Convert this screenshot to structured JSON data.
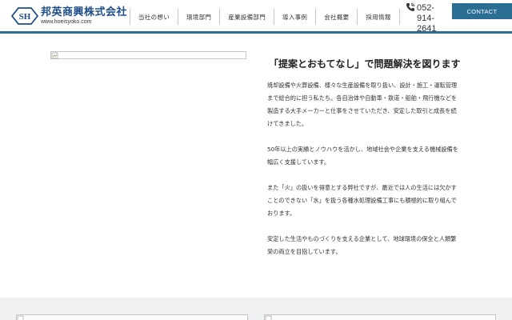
{
  "header": {
    "company_name": "邦英商興株式会社",
    "company_url": "www.hoeisyoko.com",
    "logo_icon": "sh-monogram-logo",
    "nav": [
      {
        "label": "当社の想い"
      },
      {
        "label": "環境部門"
      },
      {
        "label": "産業設備部門"
      },
      {
        "label": "導入事例"
      },
      {
        "label": "会社概要"
      },
      {
        "label": "採用情報"
      }
    ],
    "phone": {
      "icon": "phone-icon",
      "lines": [
        "052-",
        "914-",
        "2641"
      ]
    },
    "contact_label": "CONTACT",
    "accent_color": "#2a6f93"
  },
  "main": {
    "image_icon": "broken-image-icon",
    "heading": "「提案とおもてなし」で問題解決を図ります",
    "paragraphs": [
      "焼却設備や火葬設備、様々な生産設備を取り扱い、設計・施工・運転管理まで総合的に担う私たち。各自治体や自動車・鉄道・船舶・飛行機などを製造する大手メーカーと仕事をさせていただき、安定した取引と成長を続けてきました。",
      "50年以上の実績とノウハウを活かし、地域社会や企業を支える機械設備を幅広く支援しています。",
      "また「火」の扱いを得意とする弊社ですが、最近では人の生活には欠かすことのできない「水」を扱う各種水処理設備工事にも積極的に取り組んでおります。",
      "安定した生活やものづくりを支える企業として、地球環境の保全と人類繁栄の両立を目指しています。"
    ]
  }
}
